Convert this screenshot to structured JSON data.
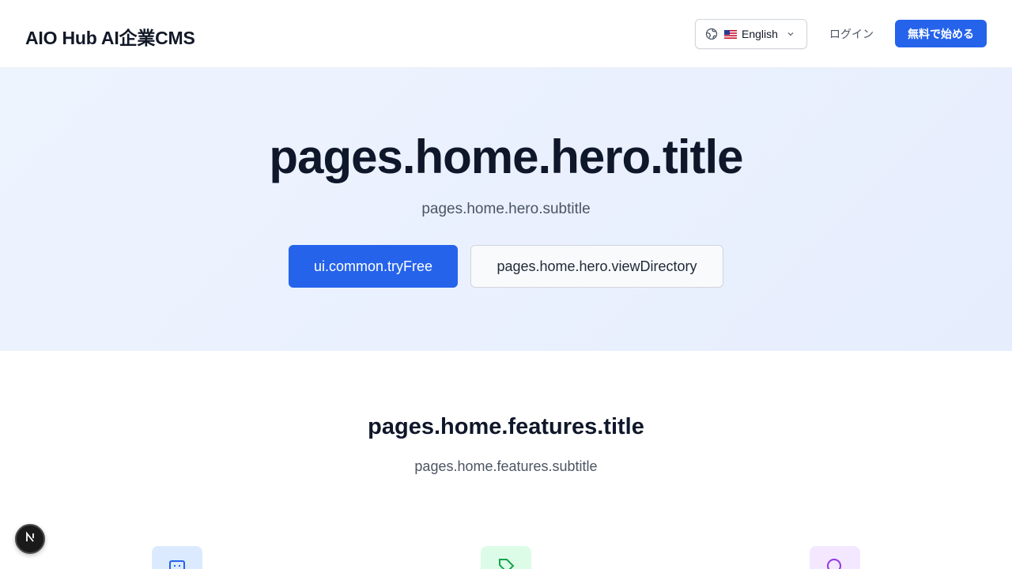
{
  "header": {
    "brand": "AIO Hub AI企業CMS",
    "language": {
      "label": "English",
      "flag_icon": "us-flag-icon",
      "icon": "globe-icon"
    },
    "login_label": "ログイン",
    "start_label": "無料で始める"
  },
  "hero": {
    "title": "pages.home.hero.title",
    "subtitle": "pages.home.hero.subtitle",
    "try_free_label": "ui.common.tryFree",
    "view_directory_label": "pages.home.hero.viewDirectory"
  },
  "features": {
    "title": "pages.home.features.title",
    "subtitle": "pages.home.features.subtitle",
    "icons": [
      "robot-icon",
      "tag-icon",
      "search-icon"
    ]
  },
  "colors": {
    "accent": "#2563eb",
    "hero_bg": "#eef4fe",
    "feature_blue": "#dbeafe",
    "feature_green": "#dcfce7",
    "feature_purple": "#f3e8ff"
  },
  "dev_badge": {
    "icon": "nextjs-icon"
  }
}
